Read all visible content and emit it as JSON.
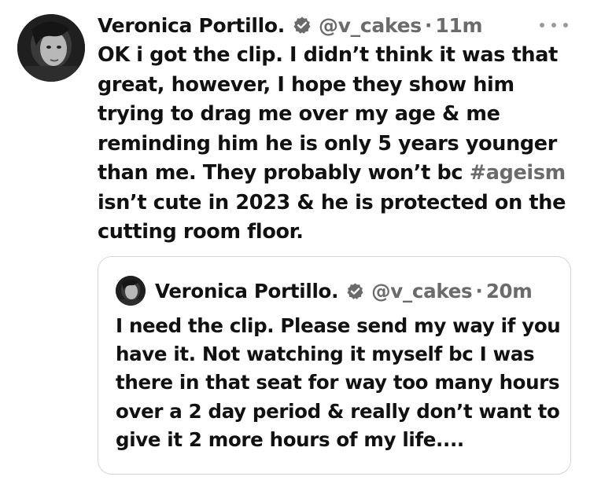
{
  "tweet": {
    "author_name": "Veronica Portillo.",
    "handle": "@v_cakes",
    "separator": "·",
    "time": "11m",
    "text_before_hashtag": "OK i got the clip.  I didn’t think it was that great, however, I hope they show him trying to drag me over my age & me reminding him he is only 5 years younger than me.  They probably won’t bc ",
    "hashtag": "#ageism",
    "text_after_hashtag": " isn’t cute in 2023 & he is protected on the cutting room floor."
  },
  "quoted_tweet": {
    "author_name": "Veronica Portillo.",
    "handle": "@v_cakes",
    "separator": "·",
    "time": "20m",
    "text": "I need the clip.  Please send my way if you have it. Not watching it myself bc I was there in that seat for way too many hours over a 2 day period & really don’t want to give it 2 more hours of my life...."
  },
  "icons": {
    "verified": "verified-badge-icon",
    "more": "more-options-icon",
    "avatar": "profile-avatar"
  },
  "colors": {
    "text": "#111111",
    "muted": "#6b6b6b",
    "border": "#d6d6d6",
    "background": "#ffffff"
  }
}
